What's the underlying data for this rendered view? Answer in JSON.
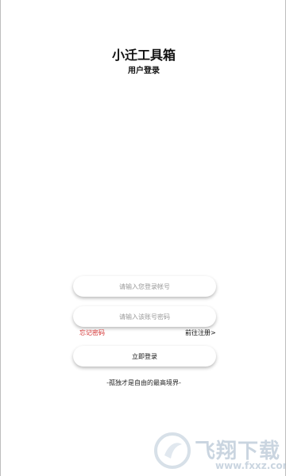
{
  "header": {
    "title": "小迁工具箱",
    "subtitle": "用户登录"
  },
  "form": {
    "account_placeholder": "请输入您登录帐号",
    "password_placeholder": "请输入该账号密码",
    "forgot_password": "忘记密码",
    "register": "前往注册>",
    "login_button": "立即登录"
  },
  "footer": {
    "motto": "-孤独才是自由的最高境界-"
  },
  "watermark": {
    "brand": "飞翔下载",
    "url": "www.fxxz.com"
  },
  "colors": {
    "forgot_link": "#d32f2f",
    "watermark": "#9fb4c8"
  }
}
